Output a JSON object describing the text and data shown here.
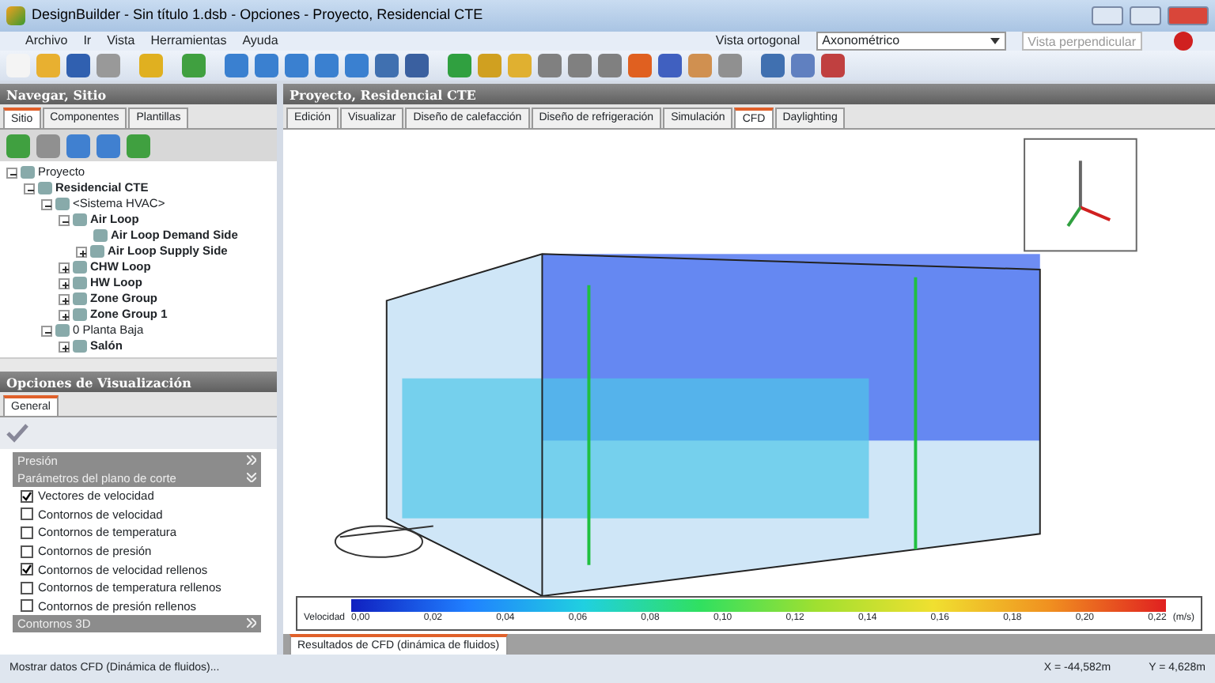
{
  "window": {
    "title": "DesignBuilder - Sin título 1.dsb - Opciones - Proyecto, Residencial CTE"
  },
  "menu": [
    "Archivo",
    "Ir",
    "Vista",
    "Herramientas",
    "Ayuda"
  ],
  "view_bar": {
    "label": "Vista ortogonal",
    "value": "Axonométrico",
    "button": "Vista perpendicular"
  },
  "left_panel": {
    "title": "Navegar, Sitio",
    "tabs": [
      {
        "label": "Sitio",
        "selected": true
      },
      {
        "label": "Componentes",
        "selected": false
      },
      {
        "label": "Plantillas",
        "selected": false
      }
    ],
    "tree": [
      {
        "label": "Proyecto",
        "bold": false,
        "expanded": true,
        "children": [
          {
            "label": "Residencial CTE",
            "bold": true,
            "expanded": true,
            "children": [
              {
                "label": "<Sistema HVAC>",
                "bold": false,
                "expanded": true,
                "children": [
                  {
                    "label": "Air Loop",
                    "bold": true,
                    "expanded": true,
                    "children": [
                      {
                        "label": "Air Loop Demand Side",
                        "bold": true
                      },
                      {
                        "label": "Air Loop Supply Side",
                        "bold": true,
                        "expanded": false
                      }
                    ]
                  },
                  {
                    "label": "CHW Loop",
                    "bold": true,
                    "expanded": false
                  },
                  {
                    "label": "HW Loop",
                    "bold": true,
                    "expanded": false
                  },
                  {
                    "label": "Zone Group",
                    "bold": true,
                    "expanded": false
                  },
                  {
                    "label": "Zone Group 1",
                    "bold": true,
                    "expanded": false
                  }
                ]
              },
              {
                "label": "0 Planta Baja",
                "bold": false,
                "expanded": true,
                "children": [
                  {
                    "label": "Salón",
                    "bold": true,
                    "expanded": false
                  }
                ]
              }
            ]
          }
        ]
      }
    ]
  },
  "options_panel": {
    "title": "Opciones de Visualización",
    "tabs": [
      {
        "label": "General",
        "selected": true
      }
    ],
    "items": [
      {
        "kind": "header",
        "label": "Presión",
        "expanded": false
      },
      {
        "kind": "header",
        "label": "Parámetros del plano de corte",
        "expanded": true
      },
      {
        "kind": "check",
        "label": "Vectores de velocidad",
        "checked": true
      },
      {
        "kind": "check",
        "label": "Contornos de velocidad",
        "checked": false
      },
      {
        "kind": "check",
        "label": "Contornos de temperatura",
        "checked": false
      },
      {
        "kind": "check",
        "label": "Contornos de presión",
        "checked": false
      },
      {
        "kind": "check",
        "label": "Contornos de velocidad rellenos",
        "checked": true
      },
      {
        "kind": "check",
        "label": "Contornos de temperatura rellenos",
        "checked": false
      },
      {
        "kind": "check",
        "label": "Contornos de presión rellenos",
        "checked": false
      },
      {
        "kind": "header",
        "label": "Contornos 3D",
        "expanded": false
      }
    ]
  },
  "main_panel": {
    "title": "Proyecto, Residencial CTE",
    "tabs": [
      {
        "label": "Edición",
        "selected": false
      },
      {
        "label": "Visualizar",
        "selected": false
      },
      {
        "label": "Diseño de calefacción",
        "selected": false
      },
      {
        "label": "Diseño de refrigeración",
        "selected": false
      },
      {
        "label": "Simulación",
        "selected": false
      },
      {
        "label": "CFD",
        "selected": true
      },
      {
        "label": "Daylighting",
        "selected": false
      }
    ],
    "legend": {
      "label": "Velocidad",
      "ticks": [
        "0,00",
        "0,02",
        "0,04",
        "0,06",
        "0,08",
        "0,10",
        "0,12",
        "0,14",
        "0,16",
        "0,18",
        "0,20",
        "0,22"
      ],
      "unit": "(m/s)"
    },
    "bottom_tabs": [
      {
        "label": "Resultados de CFD (dinámica de fluidos)",
        "selected": true
      }
    ]
  },
  "status_bar": {
    "message": "Mostrar datos CFD (Dinámica de fluidos)...",
    "x": "X = -44,582m",
    "y": "Y = 4,628m"
  }
}
